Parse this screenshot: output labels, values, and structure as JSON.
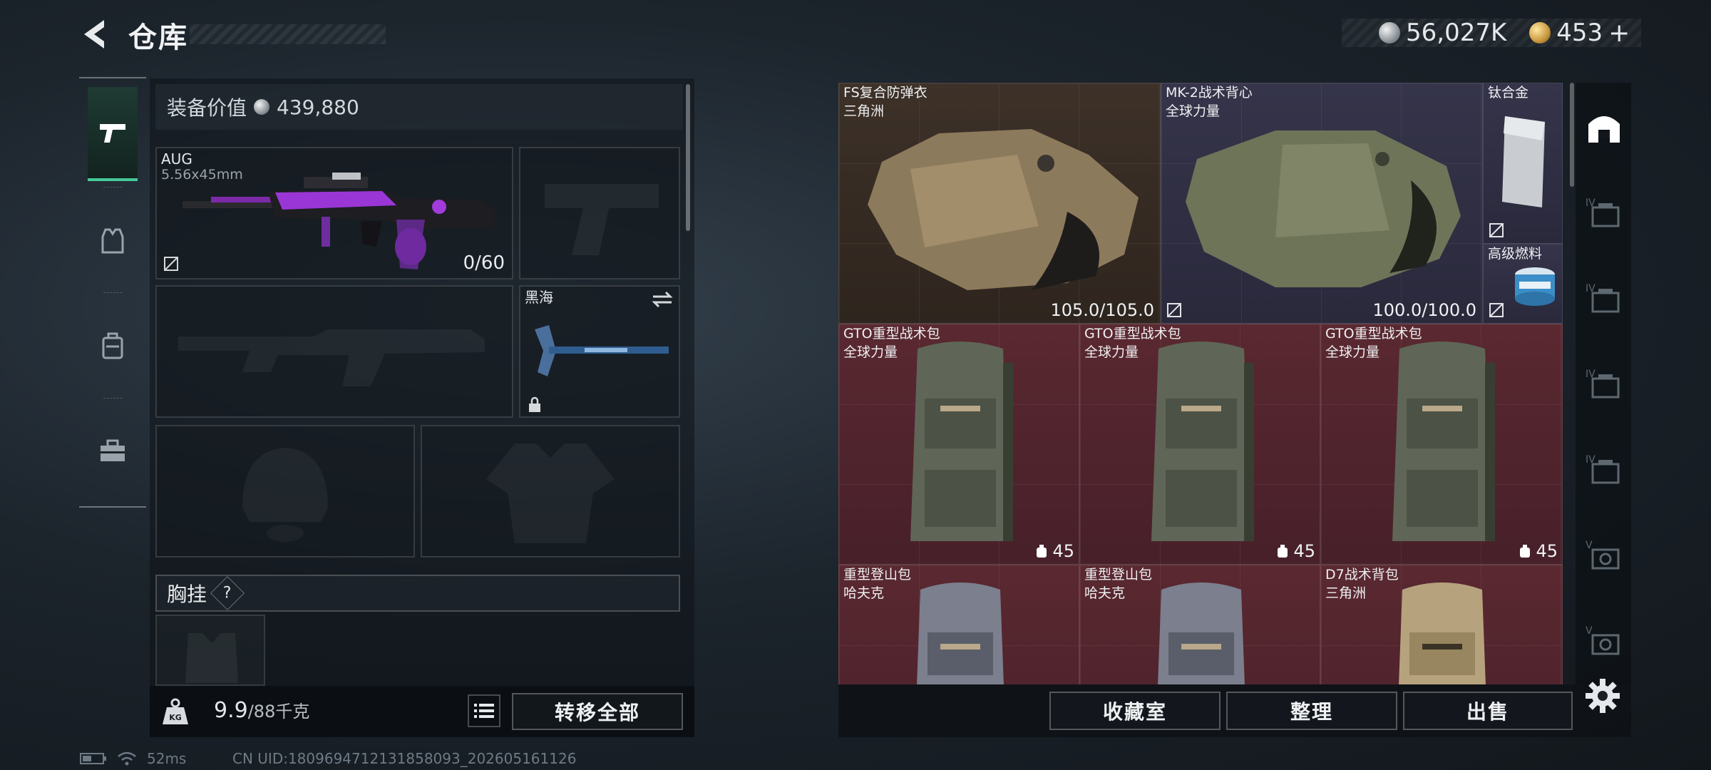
{
  "header": {
    "title": "仓库",
    "currency": {
      "silver": "56,027K",
      "gold": "453",
      "add_symbol": "+"
    }
  },
  "left_tabs": [
    {
      "name": "weapons",
      "icon": "pistol-icon",
      "active": true
    },
    {
      "name": "armor",
      "icon": "armor-vest-icon",
      "active": false
    },
    {
      "name": "backpack",
      "icon": "backpack-icon",
      "active": false
    },
    {
      "name": "toolbox",
      "icon": "toolbox-icon",
      "active": false
    }
  ],
  "equipment": {
    "value_label": "装备价值",
    "value": "439,880",
    "primary_weapon": {
      "name": "AUG",
      "caliber": "5.56x45mm",
      "ammo": "0/60"
    },
    "melee": {
      "name": "黑海"
    },
    "chest_rig_label": "胸挂",
    "chest_rig_help": "?",
    "weight": {
      "current": "9.9",
      "capacity": "/88千克"
    },
    "transfer_all": "转移全部"
  },
  "status": {
    "ping": "52ms",
    "uid": "CN UID:18096947121318580​93_202605161126"
  },
  "stash": {
    "items": [
      {
        "name": "FS复合防弹衣",
        "maker": "三角洲",
        "durability": "105.0/105.0",
        "color": "brown"
      },
      {
        "name": "MK-2战术背心",
        "maker": "全球力量",
        "durability": "100.0/100.0",
        "color": "purple"
      },
      {
        "name": "钛合金",
        "maker": "",
        "color": "purple"
      },
      {
        "name": "高级燃料",
        "maker": "",
        "color": "purple"
      },
      {
        "name": "GTO重型战术包",
        "maker": "全球力量",
        "capacity": "45",
        "color": "red"
      },
      {
        "name": "GTO重型战术包",
        "maker": "全球力量",
        "capacity": "45",
        "color": "red"
      },
      {
        "name": "GTO重型战术包",
        "maker": "全球力量",
        "capacity": "45",
        "color": "red"
      },
      {
        "name": "重型登山包",
        "maker": "哈夫克",
        "color": "red"
      },
      {
        "name": "重型登山包",
        "maker": "哈夫克",
        "color": "red"
      },
      {
        "name": "D7战术背包",
        "maker": "三角洲",
        "color": "red"
      }
    ],
    "buttons": {
      "collection": "收藏室",
      "organize": "整理",
      "sell": "出售"
    }
  },
  "right_tabs": [
    {
      "icon": "stash-home-icon",
      "label": ""
    },
    {
      "icon": "container-icon",
      "label": "IV"
    },
    {
      "icon": "container-icon",
      "label": "IV"
    },
    {
      "icon": "container-icon",
      "label": "IV"
    },
    {
      "icon": "container-icon",
      "label": "IV"
    },
    {
      "icon": "container-icon",
      "label": "V"
    },
    {
      "icon": "container-icon",
      "label": "V"
    }
  ]
}
